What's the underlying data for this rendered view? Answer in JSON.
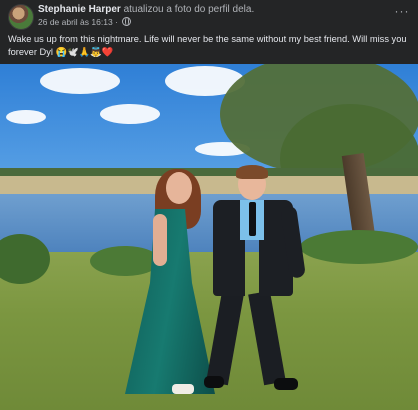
{
  "post": {
    "author": "Stephanie Harper",
    "action": "atualizou a foto do perfil dela.",
    "timestamp": "26 de abril às 16:13",
    "separator": "·",
    "more_label": "···",
    "caption": "Wake us up from this nightmare. Life will never be the same without my best friend. Will miss you forever Dyl 😭🕊️🙏👼❤️"
  },
  "icons": {
    "avatar": "profile-photo",
    "privacy": "globe-icon",
    "more": "more-options-icon"
  },
  "colors": {
    "background": "#242526",
    "primary_text": "#e4e6eb",
    "secondary_text": "#b0b3b8"
  }
}
